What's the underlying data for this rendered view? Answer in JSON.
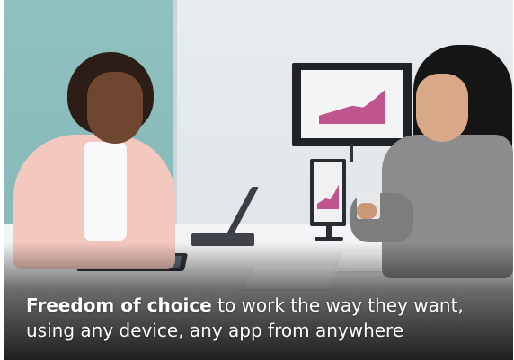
{
  "caption": {
    "bold_lead": "Freedom of choice",
    "line1_rest": " to work the way they want,",
    "line2": "using any device, any app from anywhere"
  },
  "colors": {
    "accent_chart": "#c0548f",
    "wall_teal": "#8fc1c0",
    "caption_text": "#ffffff"
  },
  "chart_data": [
    {
      "type": "area",
      "x": [
        1,
        2,
        3,
        4,
        5,
        6,
        7
      ],
      "values": [
        10,
        14,
        18,
        22,
        20,
        30,
        42
      ],
      "ylim": [
        0,
        50
      ]
    },
    {
      "type": "area",
      "x": [
        1,
        2,
        3,
        4,
        5,
        6
      ],
      "values": [
        8,
        12,
        16,
        14,
        24,
        36
      ],
      "ylim": [
        0,
        50
      ]
    }
  ]
}
